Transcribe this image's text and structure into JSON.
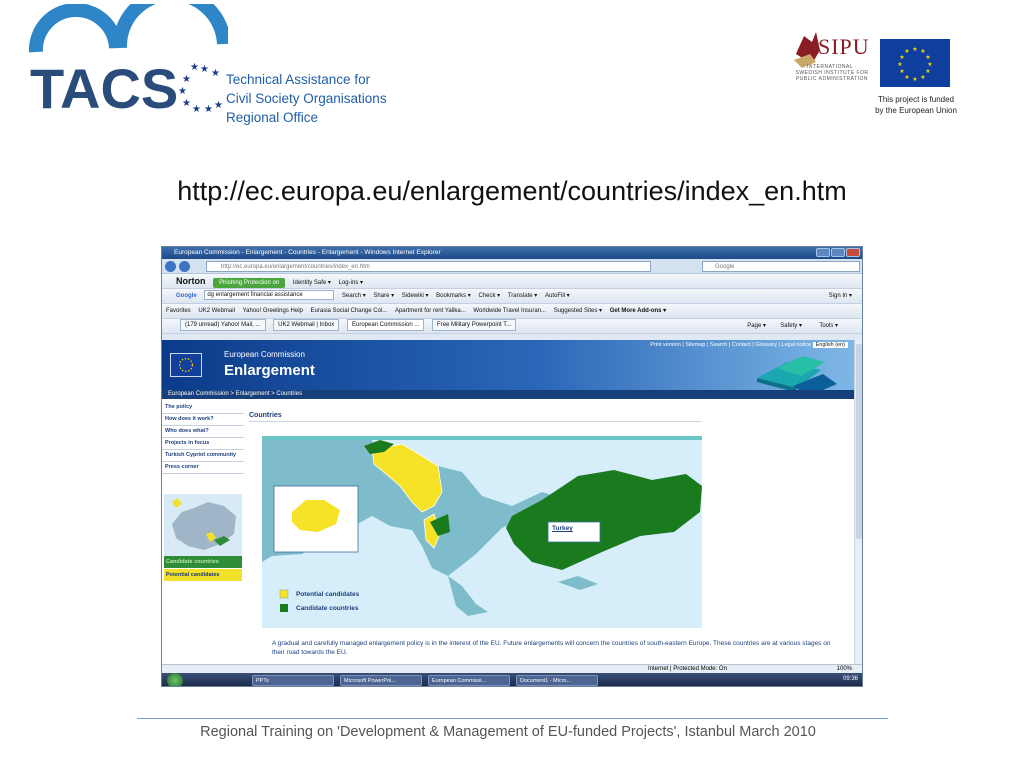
{
  "header": {
    "logo_text": "TACS",
    "subtitle_lines": [
      "Technical Assistance for",
      "Civil Society Organisations",
      "Regional Office"
    ],
    "partner_logo": "SIPU",
    "partner_small": "INTERNATIONAL · SWEDISH INSTITUTE FOR PUBLIC ADMINISTRATION",
    "eu_note_1": "This project is funded",
    "eu_note_2": "by the European Union"
  },
  "slide_title": "http://ec.europa.eu/enlargement/countries/index_en.htm",
  "browser": {
    "window_title": "European Commission - Enlargement - Countries - Enlargement - Windows Internet Explorer",
    "address": "http://ec.europa.eu/enlargement/countries/index_en.htm",
    "search_placeholder": "Google",
    "norton": {
      "logo": "Norton",
      "phishing": "Phishing Protection on",
      "identity": "Identity Safe ▾",
      "login": "Log-ins ▾"
    },
    "google_bar": {
      "label": "Google",
      "query": "dg enlargement financial assistance",
      "search": "Search ▾",
      "share": "Share ▾",
      "sidewiki": "Sidewiki ▾",
      "bookmarks": "Bookmarks ▾",
      "check": "Check ▾",
      "translate": "Translate ▾",
      "autofill": "AutoFill ▾",
      "signin": "Sign In ▾"
    },
    "favorites": [
      "Favorites",
      "UK2 Webmail",
      "Yahoo! Greetings Help",
      "Eurasia Social Change Col...",
      "Apartment for rent Yalika...",
      "Worldwide Travel Insuran...",
      "Suggested Sites ▾",
      "Get More Add-ons ▾"
    ],
    "tabs": [
      {
        "label": "(179 unread) Yahoo! Mail, ...",
        "active": false
      },
      {
        "label": "UK2 Webmail | Inbox",
        "active": false
      },
      {
        "label": "European Commission ...",
        "active": true
      },
      {
        "label": "Free Military Powerpoint T...",
        "active": false
      }
    ],
    "command_bar": [
      "Page ▾",
      "Safety ▾",
      "Tools ▾"
    ],
    "status_zone": "Internet | Protected Mode: On",
    "zoom": "100%"
  },
  "ec_page": {
    "top_links": "Print version | Sitemap | Search | Contact | Glossary | Legal notice",
    "language": "English (en)",
    "org_name": "European Commission",
    "section_name": "Enlargement",
    "breadcrumb": "European Commission > Enlargement > Countries",
    "nav": [
      "The policy",
      "How does it work?",
      "Who does what?",
      "Projects in focus",
      "Turkish Cypriot community",
      "Press corner"
    ],
    "btn_candidate": "Candidate countries",
    "btn_potential": "Potential candidates",
    "heading": "Countries",
    "map_label": "Turkey",
    "legend_potential": "Potential candidates",
    "legend_candidate": "Candidate countries",
    "intro_text": "A gradual and carefully managed enlargement policy is in the interest of the EU. Future enlargements will concern the countries of south-eastern Europe. These countries are at various stages on their road towards the EU."
  },
  "taskbar": {
    "buttons": [
      "PPTs",
      "Microsoft PowerPoi...",
      "European Commissi...",
      "Document1 - Micro..."
    ],
    "clock": "09:36"
  },
  "footer": "Regional Training on 'Development & Management of EU-funded Projects', Istanbul March 2010",
  "colors": {
    "tacs_blue": "#2a7fc2",
    "candidate_green": "#1a7a1e",
    "potential_yellow": "#f6e227",
    "sea_blue": "#d5eef9",
    "land_teal": "#7fbccb"
  }
}
